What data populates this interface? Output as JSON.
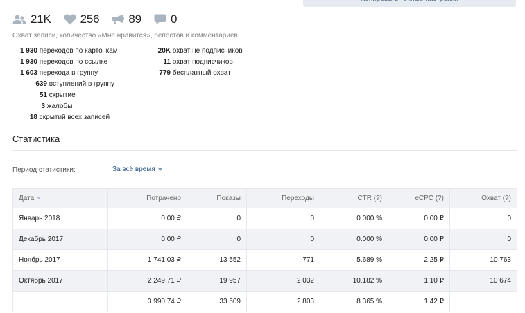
{
  "top_button": {
    "label": "Копировать точные настройки"
  },
  "stats": [
    {
      "icon": "users-icon",
      "value": "21K"
    },
    {
      "icon": "heart-icon",
      "value": "256"
    },
    {
      "icon": "megaphone-icon",
      "value": "89"
    },
    {
      "icon": "comment-icon",
      "value": "0"
    }
  ],
  "reach_description": "Охват записи, количество «Мне нравится», репостов и комментариев.",
  "metrics_left": [
    {
      "value": "1 930",
      "label": "переходов по карточкам"
    },
    {
      "value": "1 930",
      "label": "переходов по ссылке"
    },
    {
      "value": "1 603",
      "label": "перехода в группу"
    },
    {
      "value": "639",
      "label": "вступлений в группу"
    },
    {
      "value": "51",
      "label": "скрытие"
    },
    {
      "value": "3",
      "label": "жалобы"
    },
    {
      "value": "18",
      "label": "скрытий всех записей"
    }
  ],
  "metrics_right": [
    {
      "value": "20K",
      "label": "охват не подписчиков"
    },
    {
      "value": "11",
      "label": "охват подписчиков"
    },
    {
      "value": "779",
      "label": "бесплатный охват"
    }
  ],
  "section_title": "Статистика",
  "period": {
    "label": "Период статистики:",
    "value": "За всё время"
  },
  "table": {
    "columns": [
      "Дата",
      "Потрачено",
      "Показы",
      "Переходы",
      "CTR (?)",
      "eCPC (?)",
      "Охват (?)"
    ],
    "rows": [
      [
        "Январь 2018",
        "0.00 ₽",
        "0",
        "0",
        "0.000 %",
        "0.00 ₽",
        "0"
      ],
      [
        "Декабрь 2017",
        "0.00 ₽",
        "0",
        "0",
        "0.000 %",
        "0.00 ₽",
        "0"
      ],
      [
        "Ноябрь 2017",
        "1 741.03 ₽",
        "13 552",
        "771",
        "5.689 %",
        "2.25 ₽",
        "10 763"
      ],
      [
        "Октябрь 2017",
        "2 249.71 ₽",
        "19 957",
        "2 032",
        "10.182 %",
        "1.10 ₽",
        "10 674"
      ],
      [
        "",
        "3 990.74 ₽",
        "33 509",
        "2 803",
        "8.365 %",
        "1.42 ₽",
        ""
      ]
    ]
  },
  "colors": {
    "accent": "#2a5885",
    "icon": "#aab4c1",
    "header_bg": "#f0f2f5",
    "border": "#e7e8ec"
  }
}
